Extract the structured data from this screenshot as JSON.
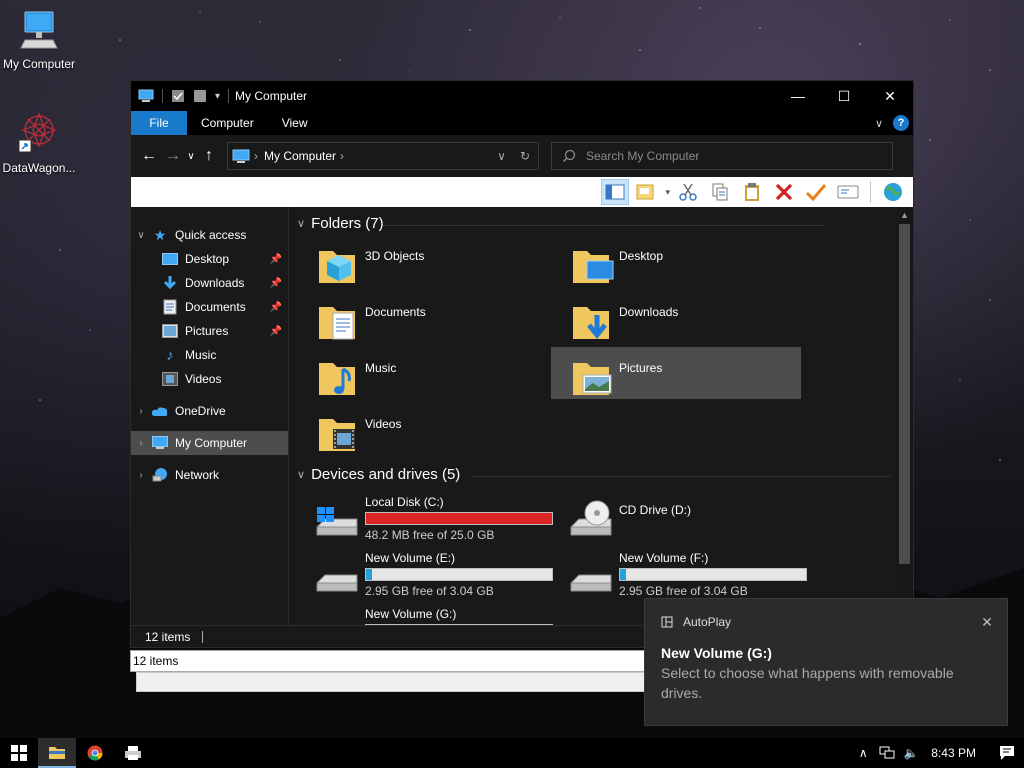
{
  "desktop": {
    "icons": [
      {
        "label": "My Computer",
        "icon": "computer-icon"
      },
      {
        "label": "DataWagon...",
        "icon": "datawagon-shortcut-icon"
      }
    ]
  },
  "window": {
    "title": "My Computer",
    "controls": {
      "minimize": "—",
      "maximize": "☐",
      "close": "✕"
    },
    "ribbon_tabs": [
      {
        "label": "File",
        "active": true
      },
      {
        "label": "Computer"
      },
      {
        "label": "View"
      }
    ],
    "help_glyph": "?",
    "address": {
      "crumb": "My Computer"
    },
    "search": {
      "placeholder": "Search My Computer"
    }
  },
  "nav_pane": {
    "quick_access": "Quick access",
    "quick_items": [
      {
        "label": "Desktop",
        "icon": "desktop-icon",
        "pinned": true
      },
      {
        "label": "Downloads",
        "icon": "downloads-icon",
        "pinned": true
      },
      {
        "label": "Documents",
        "icon": "documents-icon",
        "pinned": true
      },
      {
        "label": "Pictures",
        "icon": "pictures-icon",
        "pinned": true
      },
      {
        "label": "Music",
        "icon": "music-icon",
        "pinned": false
      },
      {
        "label": "Videos",
        "icon": "videos-icon",
        "pinned": false
      }
    ],
    "onedrive": "OneDrive",
    "my_computer": "My Computer",
    "network": "Network"
  },
  "content": {
    "folders_header": "Folders (7)",
    "folders": [
      {
        "name": "3D Objects",
        "icon": "3d-objects-folder-icon"
      },
      {
        "name": "Desktop",
        "icon": "desktop-folder-icon"
      },
      {
        "name": "Documents",
        "icon": "documents-folder-icon"
      },
      {
        "name": "Downloads",
        "icon": "downloads-folder-icon"
      },
      {
        "name": "Music",
        "icon": "music-folder-icon"
      },
      {
        "name": "Pictures",
        "icon": "pictures-folder-icon",
        "selected": true
      },
      {
        "name": "Videos",
        "icon": "videos-folder-icon"
      }
    ],
    "drives_header": "Devices and drives (5)",
    "drives": [
      {
        "name": "Local Disk (C:)",
        "free": "48.2 MB free of 25.0 GB",
        "used_fraction": 0.998,
        "status": "full"
      },
      {
        "name": "CD Drive (D:)",
        "free": "",
        "used_fraction": null,
        "status": "cd"
      },
      {
        "name": "New Volume (E:)",
        "free": "2.95 GB free of 3.04 GB",
        "used_fraction": 0.03,
        "status": "normal"
      },
      {
        "name": "New Volume (F:)",
        "free": "2.95 GB free of 3.04 GB",
        "used_fraction": 0.03,
        "status": "normal"
      },
      {
        "name": "New Volume (G:)",
        "free": "",
        "used_fraction": 0.0,
        "status": "normal"
      }
    ]
  },
  "status": {
    "items": "12 items",
    "ghost_items": "12 items"
  },
  "toast": {
    "app": "AutoPlay",
    "title": "New Volume (G:)",
    "body": "Select to choose what happens with removable drives."
  },
  "taskbar": {
    "clock": "8:43 PM",
    "tray_chevron": "∧"
  },
  "colors": {
    "accent": "#1979ca",
    "drive_bar": "#26a0da",
    "drive_full": "#da2626"
  }
}
